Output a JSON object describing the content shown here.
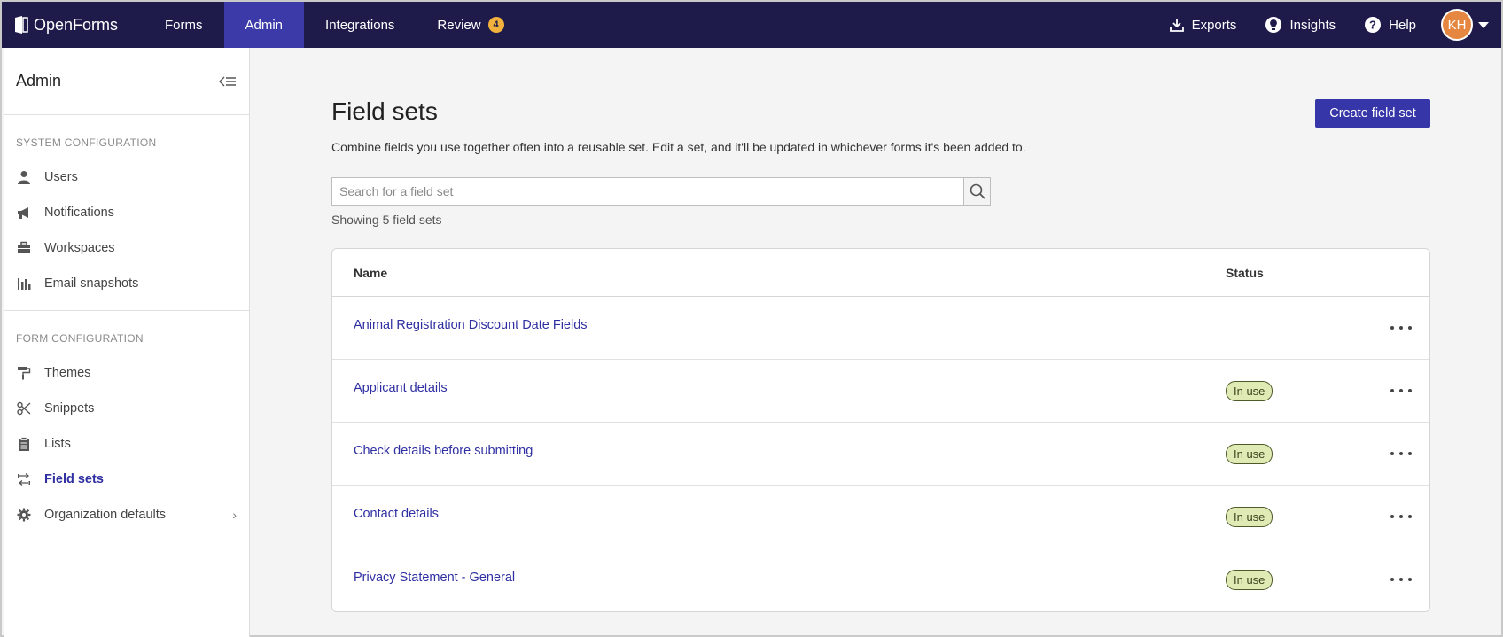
{
  "app": {
    "name": "OpenForms"
  },
  "topnav": {
    "links": [
      {
        "label": "Forms"
      },
      {
        "label": "Admin",
        "active": true
      },
      {
        "label": "Integrations"
      },
      {
        "label": "Review",
        "badge": "4"
      }
    ],
    "right": {
      "exports": "Exports",
      "insights": "Insights",
      "help": "Help",
      "avatar_initials": "KH"
    }
  },
  "sidebar": {
    "title": "Admin",
    "sections": [
      {
        "label": "SYSTEM CONFIGURATION",
        "items": [
          {
            "label": "Users",
            "icon": "user-icon"
          },
          {
            "label": "Notifications",
            "icon": "megaphone-icon"
          },
          {
            "label": "Workspaces",
            "icon": "briefcase-icon"
          },
          {
            "label": "Email snapshots",
            "icon": "bar-chart-icon"
          }
        ]
      },
      {
        "label": "FORM CONFIGURATION",
        "items": [
          {
            "label": "Themes",
            "icon": "paint-roller-icon"
          },
          {
            "label": "Snippets",
            "icon": "scissors-icon"
          },
          {
            "label": "Lists",
            "icon": "clipboard-icon"
          },
          {
            "label": "Field sets",
            "icon": "field-sets-icon",
            "active": true
          },
          {
            "label": "Organization defaults",
            "icon": "gear-icon"
          }
        ]
      }
    ]
  },
  "main": {
    "title": "Field sets",
    "create_button": "Create field set",
    "subtitle": "Combine fields you use together often into a reusable set. Edit a set, and it'll be updated in whichever forms it's been added to.",
    "search_placeholder": "Search for a field set",
    "showing": "Showing 5 field sets",
    "table": {
      "columns": [
        "Name",
        "Status"
      ],
      "rows": [
        {
          "name": "Animal Registration Discount Date Fields",
          "status": ""
        },
        {
          "name": "Applicant details",
          "status": "In use"
        },
        {
          "name": "Check details before submitting",
          "status": "In use"
        },
        {
          "name": "Contact details",
          "status": "In use"
        },
        {
          "name": "Privacy Statement - General",
          "status": "In use"
        }
      ]
    }
  },
  "colors": {
    "nav_bg": "#1e1b4b",
    "nav_active": "#3b3aa8",
    "accent": "#3636a8",
    "link": "#2f2fa2",
    "pill_bg": "#dfeab4"
  }
}
